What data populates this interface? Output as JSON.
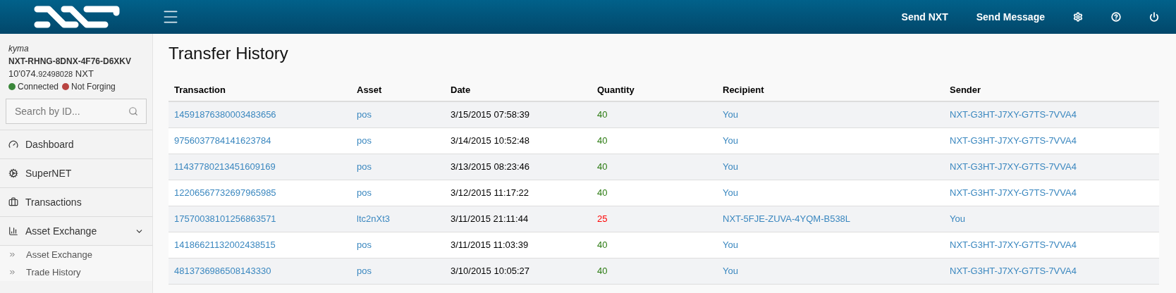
{
  "header": {
    "nav": [
      {
        "label": "Send NXT"
      },
      {
        "label": "Send Message"
      }
    ]
  },
  "account": {
    "name": "kyma",
    "address": "NXT-RHNG-8DNX-4F76-D6XKV",
    "balance_main": "10'074.",
    "balance_decimals": "92498028",
    "balance_unit": "NXT",
    "statuses": [
      {
        "label": "Connected",
        "color": "#3a873a"
      },
      {
        "label": "Not Forging",
        "color": "#b94441"
      }
    ]
  },
  "search": {
    "placeholder": "Search by ID..."
  },
  "sidebar": {
    "items": [
      {
        "kind": "dashboard",
        "label": "Dashboard"
      },
      {
        "kind": "supernet",
        "label": "SuperNET"
      },
      {
        "kind": "transactions",
        "label": "Transactions"
      },
      {
        "kind": "exchange",
        "label": "Asset Exchange",
        "expanded": true,
        "children": [
          {
            "label": "Asset Exchange"
          },
          {
            "label": "Trade History"
          }
        ]
      }
    ]
  },
  "page": {
    "title": "Transfer History"
  },
  "table": {
    "columns": [
      "Transaction",
      "Asset",
      "Date",
      "Quantity",
      "Recipient",
      "Sender"
    ],
    "rows": [
      {
        "transaction": "14591876380003483656",
        "asset": "pos",
        "date": "3/15/2015 07:58:39",
        "quantity": "40",
        "kind": "received",
        "recipient": "You",
        "sender": "NXT-G3HT-J7XY-G7TS-7VVA4"
      },
      {
        "transaction": "9756037784141623784",
        "asset": "pos",
        "date": "3/14/2015 10:52:48",
        "quantity": "40",
        "kind": "received",
        "recipient": "You",
        "sender": "NXT-G3HT-J7XY-G7TS-7VVA4"
      },
      {
        "transaction": "11437780213451609169",
        "asset": "pos",
        "date": "3/13/2015 08:23:46",
        "quantity": "40",
        "kind": "received",
        "recipient": "You",
        "sender": "NXT-G3HT-J7XY-G7TS-7VVA4"
      },
      {
        "transaction": "12206567732697965985",
        "asset": "pos",
        "date": "3/12/2015 11:17:22",
        "quantity": "40",
        "kind": "received",
        "recipient": "You",
        "sender": "NXT-G3HT-J7XY-G7TS-7VVA4"
      },
      {
        "transaction": "17570038101256863571",
        "asset": "ltc2nXt3",
        "date": "3/11/2015 21:11:44",
        "quantity": "25",
        "kind": "sent",
        "recipient": "NXT-5FJE-ZUVA-4YQM-B538L",
        "sender": "You"
      },
      {
        "transaction": "14186621132002438515",
        "asset": "pos",
        "date": "3/11/2015 11:03:39",
        "quantity": "40",
        "kind": "received",
        "recipient": "You",
        "sender": "NXT-G3HT-J7XY-G7TS-7VVA4"
      },
      {
        "transaction": "4813736986508143330",
        "asset": "pos",
        "date": "3/10/2015 10:05:27",
        "quantity": "40",
        "kind": "received",
        "recipient": "You",
        "sender": "NXT-G3HT-J7XY-G7TS-7VVA4"
      }
    ]
  }
}
